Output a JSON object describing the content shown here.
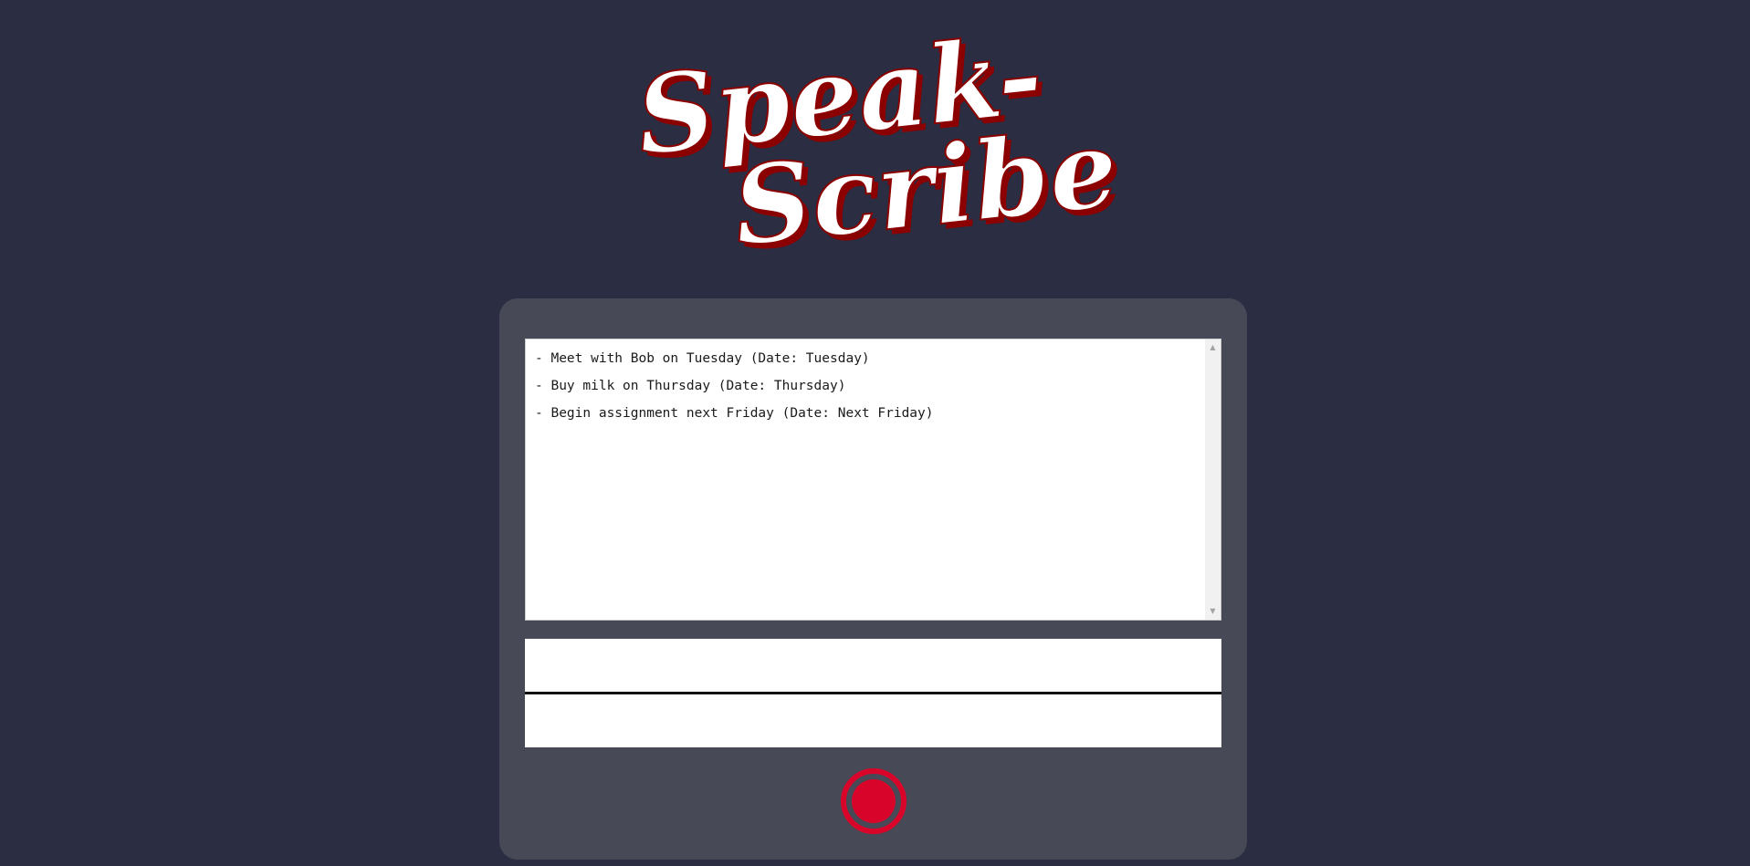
{
  "app": {
    "logo_line1": "Speak-",
    "logo_line2": "Scribe"
  },
  "colors": {
    "background": "#2b2d42",
    "panel": "#474a56",
    "accent_red": "#d90429",
    "logo_shadow": "#8b0000",
    "logo_fill": "#ffffff"
  },
  "transcript": {
    "lines": [
      "- Meet with Bob on Tuesday (Date: Tuesday)",
      "- Buy milk on Thursday (Date: Thursday)",
      "- Begin assignment next Friday (Date: Next Friday)"
    ]
  },
  "icons": {
    "record": "record-icon",
    "scroll_up": "scroll-up-arrow-icon",
    "scroll_down": "scroll-down-arrow-icon"
  }
}
